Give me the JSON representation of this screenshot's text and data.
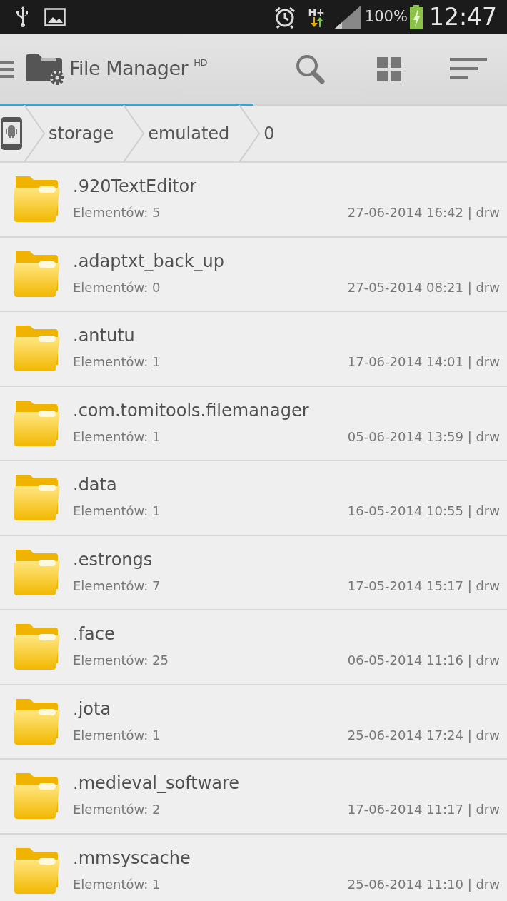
{
  "status_bar": {
    "network": "H+",
    "battery": "100%",
    "time": "12:47"
  },
  "app_bar": {
    "title": "File Manager",
    "title_suffix": "HD",
    "progress": {
      "level": 0.5
    }
  },
  "breadcrumb": [
    "storage",
    "emulated",
    "0"
  ],
  "files": [
    {
      "name": ".920TextEditor",
      "count": "Elementów: 5",
      "meta": "27-06-2014 16:42 | drw"
    },
    {
      "name": ".adaptxt_back_up",
      "count": "Elementów: 0",
      "meta": "27-05-2014 08:21 | drw"
    },
    {
      "name": ".antutu",
      "count": "Elementów: 1",
      "meta": "17-06-2014 14:01 | drw"
    },
    {
      "name": ".com.tomitools.filemanager",
      "count": "Elementów: 1",
      "meta": "05-06-2014 13:59 | drw"
    },
    {
      "name": ".data",
      "count": "Elementów: 1",
      "meta": "16-05-2014 10:55 | drw"
    },
    {
      "name": ".estrongs",
      "count": "Elementów: 7",
      "meta": "17-05-2014 15:17 | drw"
    },
    {
      "name": ".face",
      "count": "Elementów: 25",
      "meta": "06-05-2014 11:16 | drw"
    },
    {
      "name": ".jota",
      "count": "Elementów: 1",
      "meta": "25-06-2014 17:24 | drw"
    },
    {
      "name": ".medieval_software",
      "count": "Elementów: 2",
      "meta": "17-06-2014 11:17 | drw"
    },
    {
      "name": ".mmsyscache",
      "count": "Elementów: 1",
      "meta": "25-06-2014 11:10 | drw"
    }
  ]
}
